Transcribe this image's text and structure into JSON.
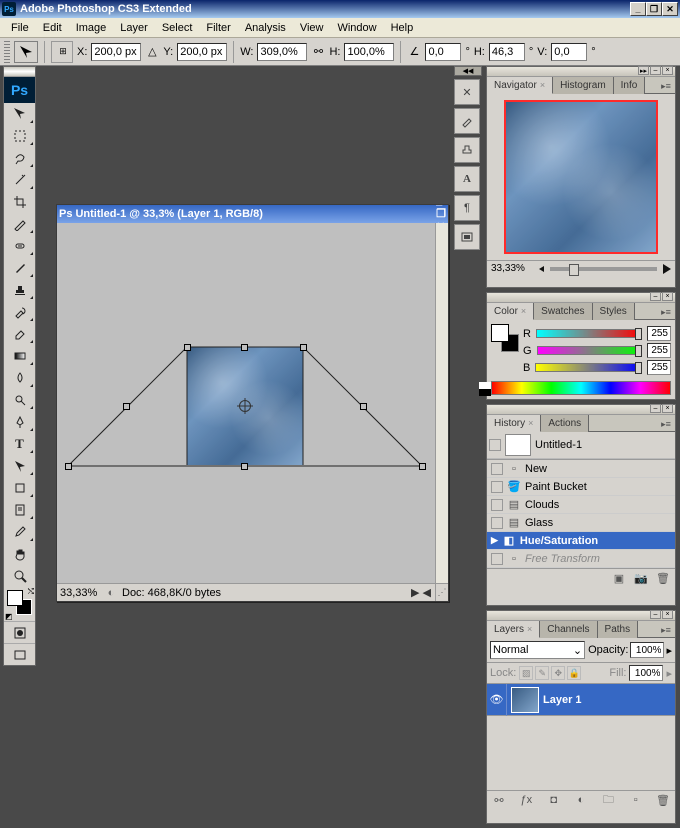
{
  "app": {
    "title": "Adobe Photoshop CS3 Extended"
  },
  "menu": [
    "File",
    "Edit",
    "Image",
    "Layer",
    "Select",
    "Filter",
    "Analysis",
    "View",
    "Window",
    "Help"
  ],
  "options": {
    "x_label": "X:",
    "x_val": "200,0 px",
    "y_label": "Y:",
    "y_val": "200,0 px",
    "w_label": "W:",
    "w_val": "309,0%",
    "h_label": "H:",
    "h_val": "100,0%",
    "angle_label": "",
    "angle_val": "0,0",
    "angle_unit": "°",
    "h_skew_label": "H:",
    "h_skew_val": "46,3",
    "h_skew_unit": "°",
    "v_skew_label": "V:",
    "v_skew_val": "0,0",
    "v_skew_unit": "°"
  },
  "document": {
    "title": "Untitled-1 @ 33,3% (Layer 1, RGB/8)",
    "zoom": "33,33%",
    "info": "Doc: 468,8K/0 bytes"
  },
  "navigator": {
    "tabs": [
      "Navigator",
      "Histogram",
      "Info"
    ],
    "zoom": "33,33%"
  },
  "color": {
    "tabs": [
      "Color",
      "Swatches",
      "Styles"
    ],
    "r_label": "R",
    "g_label": "G",
    "b_label": "B",
    "r_val": "255",
    "g_val": "255",
    "b_val": "255"
  },
  "history": {
    "tabs": [
      "History",
      "Actions"
    ],
    "snapshot": "Untitled-1",
    "items": [
      {
        "label": "New",
        "sel": false
      },
      {
        "label": "Paint Bucket",
        "sel": false
      },
      {
        "label": "Clouds",
        "sel": false
      },
      {
        "label": "Glass",
        "sel": false
      },
      {
        "label": "Hue/Saturation",
        "sel": true
      },
      {
        "label": "Free Transform",
        "sel": false,
        "future": true
      }
    ]
  },
  "layers": {
    "tabs": [
      "Layers",
      "Channels",
      "Paths"
    ],
    "blend": "Normal",
    "opacity_label": "Opacity:",
    "opacity_val": "100%",
    "lock_label": "Lock:",
    "fill_label": "Fill:",
    "fill_val": "100%",
    "layer_name": "Layer 1"
  }
}
